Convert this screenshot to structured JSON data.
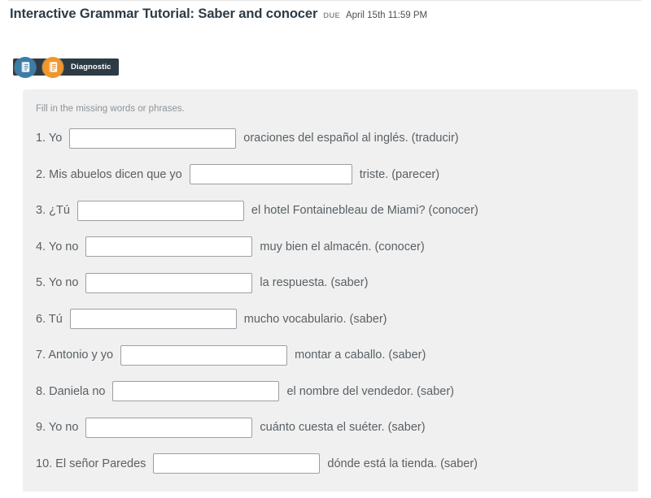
{
  "header": {
    "title": "Interactive Grammar Tutorial: Saber and conocer",
    "due_label": "DUE",
    "due_date": "April 15th 11:59 PM"
  },
  "badge_bar": {
    "tooltip_label": "Diagnostic",
    "icons": [
      {
        "name": "document-icon-blue",
        "color": "#3c7ca8"
      },
      {
        "name": "document-icon-orange",
        "color": "#f0962b"
      }
    ]
  },
  "quiz": {
    "instructions": "Fill in the missing words or phrases.",
    "questions": [
      {
        "number": "1.",
        "prefix": "Yo",
        "suffix": "oraciones del español al inglés. (traducir)",
        "answer": "",
        "blank_width": 205
      },
      {
        "number": "2.",
        "prefix": "Mis abuelos dicen que yo",
        "suffix": "triste. (parecer)",
        "answer": "",
        "blank_width": 200
      },
      {
        "number": "3.",
        "prefix": "¿Tú",
        "suffix": "el hotel Fontainebleau de Miami? (conocer)",
        "answer": "",
        "blank_width": 205
      },
      {
        "number": "4.",
        "prefix": "Yo no",
        "suffix": "muy bien el almacén. (conocer)",
        "answer": "",
        "blank_width": 205
      },
      {
        "number": "5.",
        "prefix": "Yo no",
        "suffix": "la respuesta. (saber)",
        "answer": "",
        "blank_width": 205
      },
      {
        "number": "6.",
        "prefix": "Tú",
        "suffix": "mucho vocabulario. (saber)",
        "answer": "",
        "blank_width": 205
      },
      {
        "number": "7.",
        "prefix": "Antonio y yo",
        "suffix": "montar a caballo. (saber)",
        "answer": "",
        "blank_width": 205
      },
      {
        "number": "8.",
        "prefix": "Daniela no",
        "suffix": "el nombre del vendedor. (saber)",
        "answer": "",
        "blank_width": 205
      },
      {
        "number": "9.",
        "prefix": "Yo no",
        "suffix": "cuánto cuesta el suéter. (saber)",
        "answer": "",
        "blank_width": 205
      },
      {
        "number": "10.",
        "prefix": "El señor Paredes",
        "suffix": "dónde está la tienda. (saber)",
        "answer": "",
        "blank_width": 205
      }
    ]
  }
}
